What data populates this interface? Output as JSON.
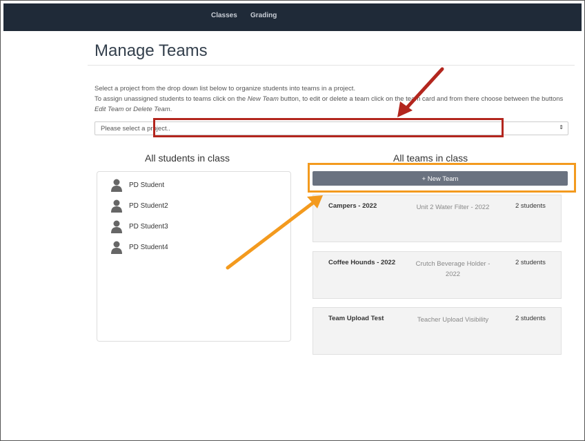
{
  "nav": {
    "items": [
      "Classes",
      "Grading"
    ]
  },
  "page": {
    "title": "Manage Teams",
    "intro_line1": "Select a project from the drop down list below to organize students into teams in a project.",
    "intro_line2_a": "To assign unassigned students to teams click on the ",
    "intro_new_team": "New Team",
    "intro_line2_b": " button, to edit or delete a team click on the team card and from there choose between the buttons ",
    "intro_edit_team": "Edit Team",
    "intro_or": " or ",
    "intro_delete_team": "Delete Team",
    "intro_end": "."
  },
  "project_select": {
    "placeholder": "Please select a project..",
    "caret_icon": "updown-caret-icon"
  },
  "students": {
    "heading": "All students in class",
    "items": [
      "PD Student",
      "PD Student2",
      "PD Student3",
      "PD Student4"
    ],
    "icon": "user-icon"
  },
  "teams": {
    "heading": "All teams in class",
    "new_team_label": "+ New Team",
    "cards": [
      {
        "name": "Campers - 2022",
        "project": "Unit 2 Water Filter - 2022",
        "count": "2 students"
      },
      {
        "name": "Coffee Hounds - 2022",
        "project": "Crutch Beverage Holder - 2022",
        "count": "2 students"
      },
      {
        "name": "Team Upload Test",
        "project": "Teacher Upload Visibility",
        "count": "2 students"
      }
    ]
  },
  "annotations": {
    "red_color": "#b3261e",
    "orange_color": "#f39a1e"
  }
}
